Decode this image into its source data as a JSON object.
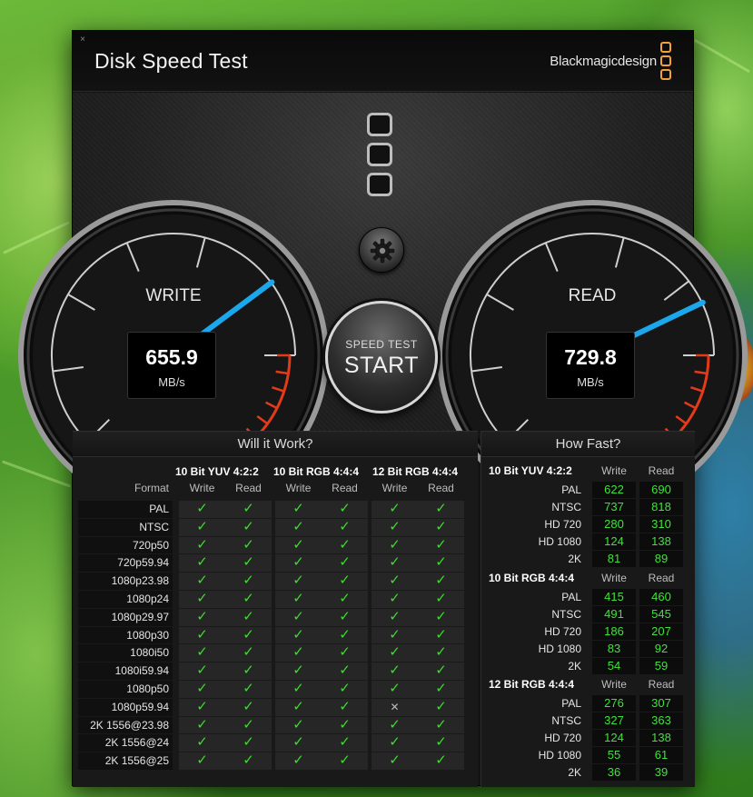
{
  "window": {
    "close_glyph": "×",
    "title": "Disk Speed Test",
    "brand": "Blackmagicdesign"
  },
  "gauges": {
    "write": {
      "label": "WRITE",
      "value": "655.9",
      "unit": "MB/s",
      "speed": 655.9
    },
    "read": {
      "label": "READ",
      "value": "729.8",
      "unit": "MB/s",
      "speed": 729.8
    },
    "needle_color": "#1aa7ec",
    "redzone_color": "#e43a1a"
  },
  "start_button": {
    "small_label": "SPEED TEST",
    "label": "START"
  },
  "will_it_work": {
    "title": "Will it Work?",
    "format_header": "Format",
    "groups": [
      "10 Bit YUV 4:2:2",
      "10 Bit RGB 4:4:4",
      "12 Bit RGB 4:4:4"
    ],
    "sub_headers": [
      "Write",
      "Read",
      "Write",
      "Read",
      "Write",
      "Read"
    ],
    "rows": [
      {
        "format": "PAL",
        "cells": [
          "✓",
          "✓",
          "✓",
          "✓",
          "✓",
          "✓"
        ]
      },
      {
        "format": "NTSC",
        "cells": [
          "✓",
          "✓",
          "✓",
          "✓",
          "✓",
          "✓"
        ]
      },
      {
        "format": "720p50",
        "cells": [
          "✓",
          "✓",
          "✓",
          "✓",
          "✓",
          "✓"
        ]
      },
      {
        "format": "720p59.94",
        "cells": [
          "✓",
          "✓",
          "✓",
          "✓",
          "✓",
          "✓"
        ]
      },
      {
        "format": "1080p23.98",
        "cells": [
          "✓",
          "✓",
          "✓",
          "✓",
          "✓",
          "✓"
        ]
      },
      {
        "format": "1080p24",
        "cells": [
          "✓",
          "✓",
          "✓",
          "✓",
          "✓",
          "✓"
        ]
      },
      {
        "format": "1080p29.97",
        "cells": [
          "✓",
          "✓",
          "✓",
          "✓",
          "✓",
          "✓"
        ]
      },
      {
        "format": "1080p30",
        "cells": [
          "✓",
          "✓",
          "✓",
          "✓",
          "✓",
          "✓"
        ]
      },
      {
        "format": "1080i50",
        "cells": [
          "✓",
          "✓",
          "✓",
          "✓",
          "✓",
          "✓"
        ]
      },
      {
        "format": "1080i59.94",
        "cells": [
          "✓",
          "✓",
          "✓",
          "✓",
          "✓",
          "✓"
        ]
      },
      {
        "format": "1080p50",
        "cells": [
          "✓",
          "✓",
          "✓",
          "✓",
          "✓",
          "✓"
        ]
      },
      {
        "format": "1080p59.94",
        "cells": [
          "✓",
          "✓",
          "✓",
          "✓",
          "✕",
          "✓"
        ]
      },
      {
        "format": "2K 1556@23.98",
        "cells": [
          "✓",
          "✓",
          "✓",
          "✓",
          "✓",
          "✓"
        ]
      },
      {
        "format": "2K 1556@24",
        "cells": [
          "✓",
          "✓",
          "✓",
          "✓",
          "✓",
          "✓"
        ]
      },
      {
        "format": "2K 1556@25",
        "cells": [
          "✓",
          "✓",
          "✓",
          "✓",
          "✓",
          "✓"
        ]
      }
    ]
  },
  "how_fast": {
    "title": "How Fast?",
    "col_write": "Write",
    "col_read": "Read",
    "groups": [
      {
        "name": "10 Bit YUV 4:2:2",
        "rows": [
          {
            "format": "PAL",
            "write": "622",
            "read": "690"
          },
          {
            "format": "NTSC",
            "write": "737",
            "read": "818"
          },
          {
            "format": "HD 720",
            "write": "280",
            "read": "310"
          },
          {
            "format": "HD 1080",
            "write": "124",
            "read": "138"
          },
          {
            "format": "2K",
            "write": "81",
            "read": "89"
          }
        ]
      },
      {
        "name": "10 Bit RGB 4:4:4",
        "rows": [
          {
            "format": "PAL",
            "write": "415",
            "read": "460"
          },
          {
            "format": "NTSC",
            "write": "491",
            "read": "545"
          },
          {
            "format": "HD 720",
            "write": "186",
            "read": "207"
          },
          {
            "format": "HD 1080",
            "write": "83",
            "read": "92"
          },
          {
            "format": "2K",
            "write": "54",
            "read": "59"
          }
        ]
      },
      {
        "name": "12 Bit RGB 4:4:4",
        "rows": [
          {
            "format": "PAL",
            "write": "276",
            "read": "307"
          },
          {
            "format": "NTSC",
            "write": "327",
            "read": "363"
          },
          {
            "format": "HD 720",
            "write": "124",
            "read": "138"
          },
          {
            "format": "HD 1080",
            "write": "55",
            "read": "61"
          },
          {
            "format": "2K",
            "write": "36",
            "read": "39"
          }
        ]
      }
    ]
  }
}
